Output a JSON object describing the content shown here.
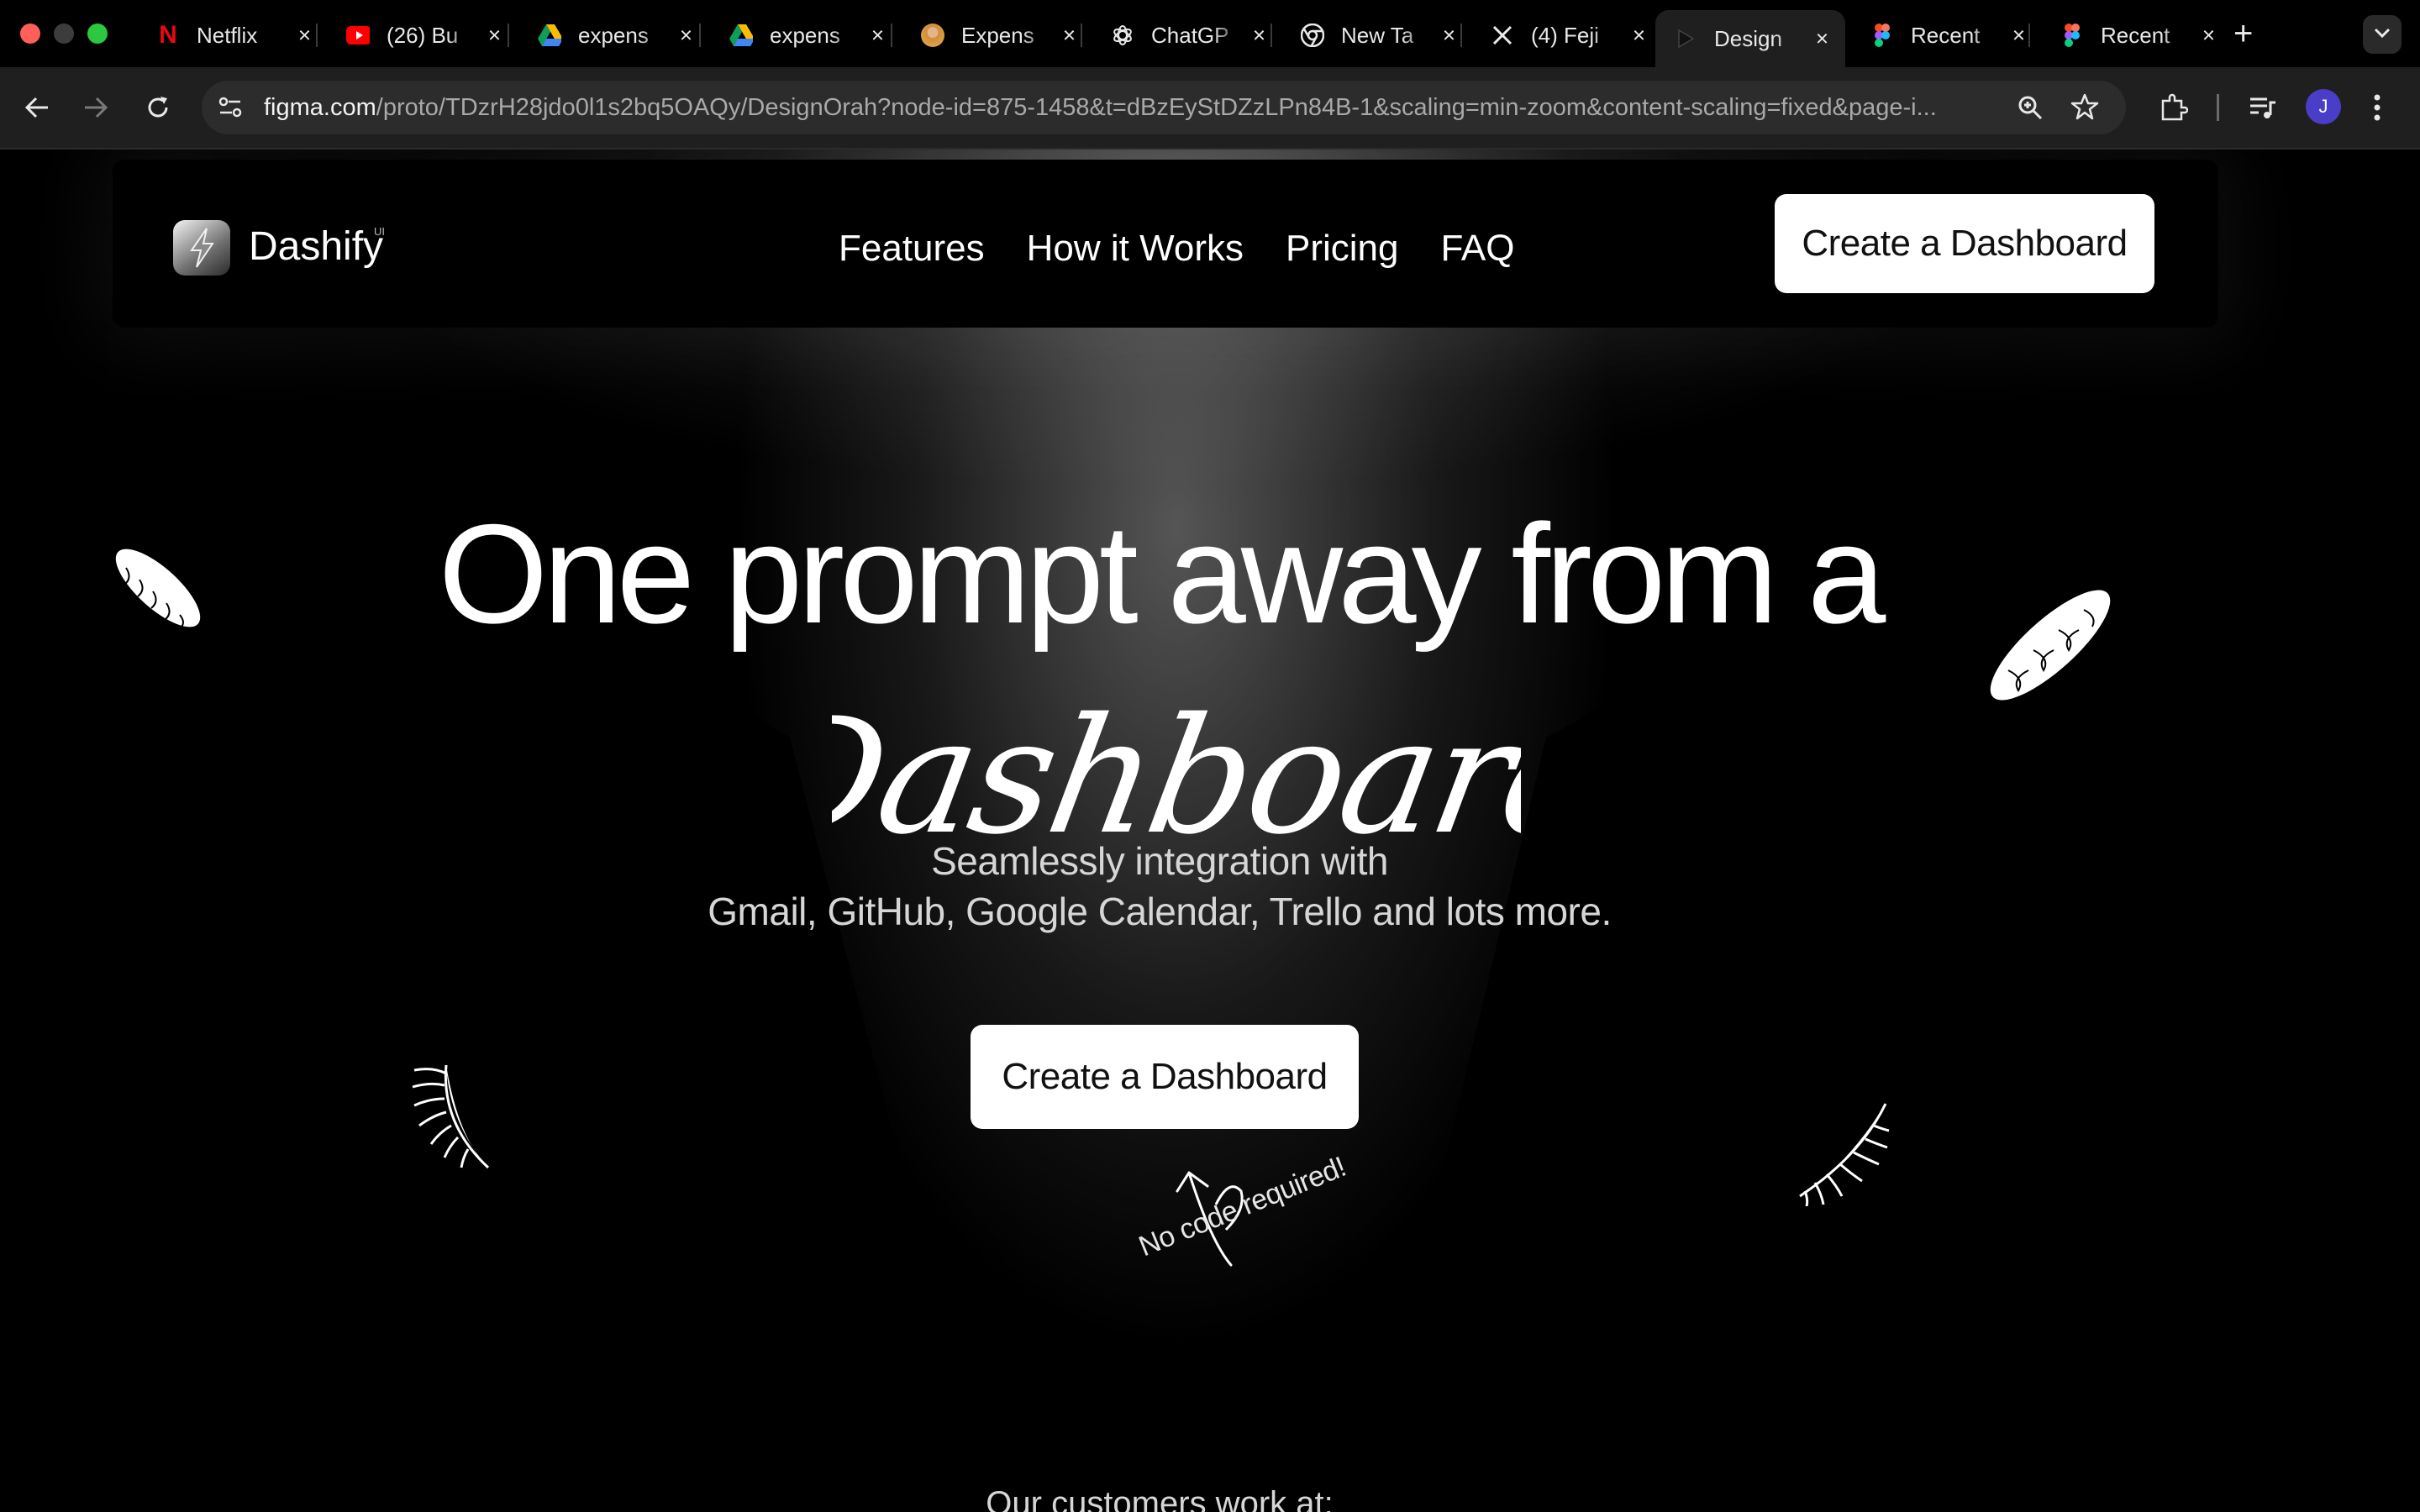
{
  "browser": {
    "tabs": [
      {
        "title": "Netflix",
        "icon": "netflix-icon",
        "active": false
      },
      {
        "title": "(26) Bu",
        "icon": "youtube-icon",
        "active": false
      },
      {
        "title": "expens",
        "icon": "google-drive-icon",
        "active": false
      },
      {
        "title": "expens",
        "icon": "google-drive-icon",
        "active": false
      },
      {
        "title": "Expens",
        "icon": "avatar-icon",
        "active": false
      },
      {
        "title": "ChatGP",
        "icon": "chatgpt-icon",
        "active": false
      },
      {
        "title": "New Ta",
        "icon": "chrome-icon",
        "active": false
      },
      {
        "title": "(4) Feji",
        "icon": "x-logo-icon",
        "active": false
      },
      {
        "title": "Design",
        "icon": "figma-play-icon",
        "active": true
      },
      {
        "title": "Recent",
        "icon": "figma-icon",
        "active": false
      },
      {
        "title": "Recent",
        "icon": "figma-icon",
        "active": false
      }
    ],
    "close_glyph": "×",
    "new_tab_glyph": "+",
    "url_host": "figma.com",
    "url_path": "/proto/TDzrH28jdo0l1s2bq5OAQy/DesignOrah?node-id=875-1458&t=dBzEyStDZzLPn84B-1&scaling=min-zoom&content-scaling=fixed&page-i...",
    "profile_initial": "J"
  },
  "site": {
    "brand": "Dashify",
    "brand_sup": "UI",
    "nav": [
      "Features",
      "How it Works",
      "Pricing",
      "FAQ"
    ],
    "cta_top": "Create a Dashboard",
    "headline": "One prompt away from a",
    "headline_script": "Dashboard",
    "subhead_line1": "Seamlessly integration with",
    "subhead_line2": "Gmail, GitHub, Google Calendar, Trello and lots more.",
    "cta_main": "Create a Dashboard",
    "note": "No code required!",
    "customers": "Our customers work at:"
  }
}
